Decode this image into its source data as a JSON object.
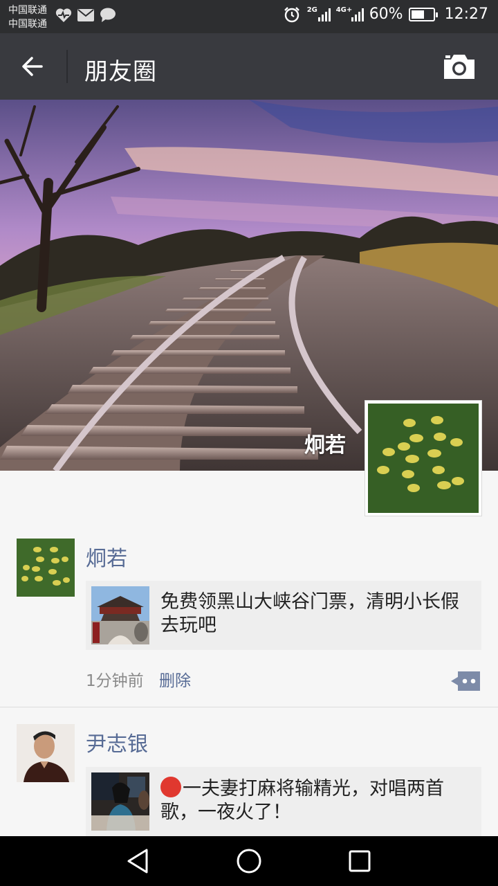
{
  "status_bar": {
    "carrier1": "中国联通",
    "carrier2": "中国联通",
    "battery_percent": "60%",
    "time": "12:27",
    "network_tag_1": "2G",
    "network_tag_2": "4G+",
    "battery_level": 0.6
  },
  "header": {
    "title": "朋友圈"
  },
  "cover": {
    "owner_name": "炯若"
  },
  "posts": [
    {
      "user": "炯若",
      "link_text": "免费领黑山大峡谷门票，清明小长假去玩吧",
      "time": "1分钟前",
      "delete_label": "删除"
    },
    {
      "user": "尹志银",
      "link_text": "一夫妻打麻将输精光，对唱两首歌，一夜火了！"
    }
  ],
  "colors": {
    "header_bg": "#393a3f",
    "status_bg": "#2d2e30",
    "link_blue": "#576b95",
    "feed_bg": "#f6f6f6"
  },
  "icons": [
    "back-arrow-icon",
    "camera-icon",
    "comment-icon",
    "heart-icon",
    "mail-icon",
    "chat-icon",
    "alarm-icon",
    "signal-icon",
    "battery-icon",
    "nav-back-icon",
    "nav-home-icon",
    "nav-recent-icon"
  ]
}
